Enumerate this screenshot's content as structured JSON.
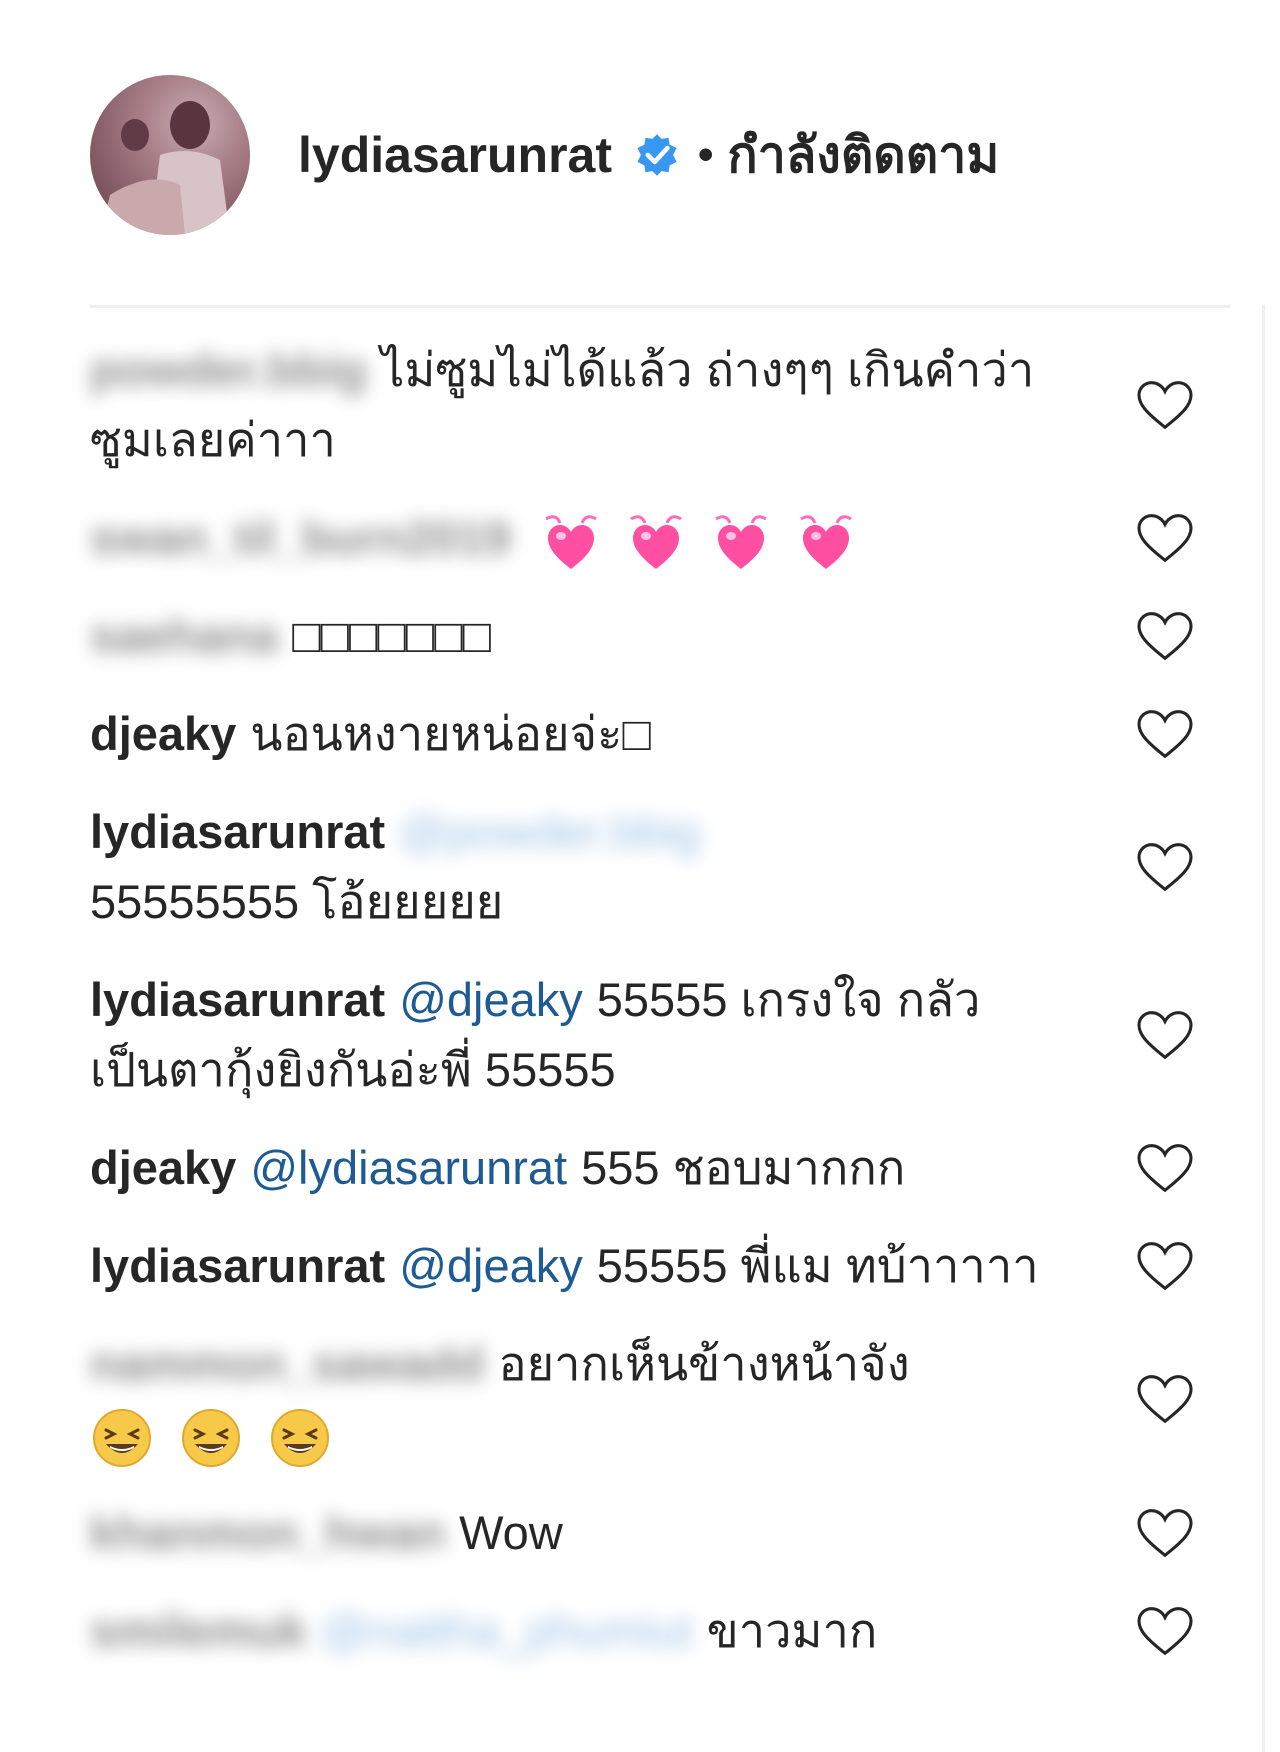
{
  "header": {
    "username": "lydiasarunrat",
    "separator": "•",
    "follow_status": "กำลังติดตาม"
  },
  "comments": [
    {
      "user": "powder.bbig",
      "text": "ไม่ซูมไม่ได้แล้ว ถ่างๆๆ เกินคำว่าซูมเลยค่าาา",
      "user_blurred": true
    },
    {
      "user": "swan_til_burn2019",
      "hearts": 4,
      "user_blurred": true
    },
    {
      "user": "saehana",
      "text": "□□□□□□□",
      "user_blurred": true
    },
    {
      "user": "djeaky",
      "text": "นอนหงายหน่อยจ่ะ□"
    },
    {
      "user": "lydiasarunrat",
      "mention": "@powder.bbig",
      "text": "55555555 โอ้ยยยยย",
      "mention_blurred": true
    },
    {
      "user": "lydiasarunrat",
      "mention": "@djeaky",
      "text": "55555 เกรงใจ กลัวเป็นตากุ้งยิงกันอ่ะพี่ 55555"
    },
    {
      "user": "djeaky",
      "mention": "@lydiasarunrat",
      "text": "555 ชอบมากกก"
    },
    {
      "user": "lydiasarunrat",
      "mention": "@djeaky",
      "text": "55555 พี่แม ทบ้าาาาา"
    },
    {
      "user": "nammon_sawadd",
      "text": "อยากเห็นข้างหน้าจัง",
      "laughs": 3,
      "user_blurred": true
    },
    {
      "user": "khanmon_hwan",
      "text": "Wow",
      "user_blurred": true
    },
    {
      "user": "smilemuk",
      "mention": "@nattha_phumiut",
      "text": "ขาวมาก",
      "user_blurred": true,
      "mention_blurred": true
    }
  ],
  "colors": {
    "text": "#262626",
    "mention": "#1e5a94",
    "verified": "#3897f0",
    "heart_emoji": "#ff4fa3",
    "like_outline": "#262626"
  },
  "icons": {
    "verified": "verified-badge-icon",
    "like": "heart-outline-icon",
    "heart_emoji": "heart-with-ribbon-emoji",
    "laugh_emoji": "grinning-squinting-face-emoji"
  }
}
